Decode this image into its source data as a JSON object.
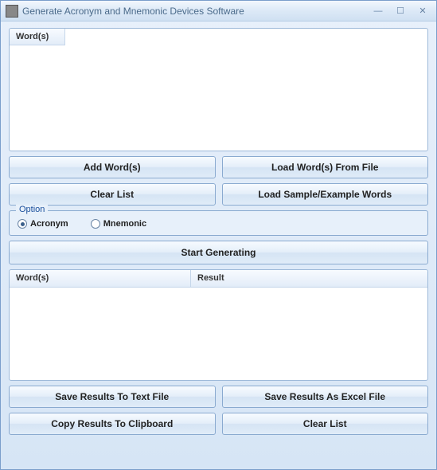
{
  "window": {
    "title": "Generate Acronym and Mnemonic Devices Software"
  },
  "input": {
    "header": "Word(s)"
  },
  "buttons": {
    "add_words": "Add Word(s)",
    "load_from_file": "Load Word(s) From File",
    "clear_list_top": "Clear List",
    "load_sample": "Load Sample/Example Words",
    "start": "Start Generating",
    "save_text": "Save Results To Text File",
    "save_excel": "Save Results As Excel File",
    "copy_clipboard": "Copy Results To Clipboard",
    "clear_list_bottom": "Clear List"
  },
  "option": {
    "legend": "Option",
    "acronym": "Acronym",
    "mnemonic": "Mnemonic",
    "selected": "Acronym"
  },
  "results": {
    "col_words": "Word(s)",
    "col_result": "Result"
  }
}
